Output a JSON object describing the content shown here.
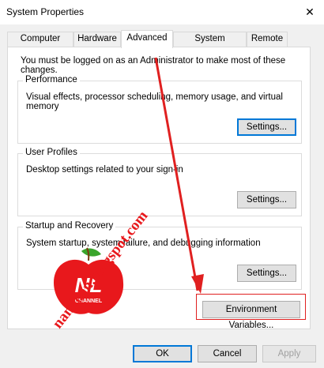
{
  "window": {
    "title": "System Properties",
    "close_glyph": "✕"
  },
  "tabs": [
    {
      "label": "Computer Name"
    },
    {
      "label": "Hardware"
    },
    {
      "label": "Advanced",
      "active": true
    },
    {
      "label": "System Protection"
    },
    {
      "label": "Remote"
    }
  ],
  "notice": "You must be logged on as an Administrator to make most of these changes.",
  "groups": {
    "performance": {
      "title": "Performance",
      "description": "Visual effects, processor scheduling, memory usage, and virtual memory",
      "button": "Settings..."
    },
    "user_profiles": {
      "title": "User Profiles",
      "description": "Desktop settings related to your sign-in",
      "button": "Settings..."
    },
    "startup_recovery": {
      "title": "Startup and Recovery",
      "description": "System startup, system failure, and debugging information",
      "button": "Settings..."
    }
  },
  "env_button": "Environment Variables...",
  "footer": {
    "ok": "OK",
    "cancel": "Cancel",
    "apply": "Apply"
  },
  "watermark": {
    "logo_text": "NL",
    "logo_subtext": "CHANNEL",
    "site": "namloan.blogspot.com"
  },
  "colors": {
    "annotation_red": "#e02020",
    "focus_blue": "#0078d7",
    "logo_red": "#e8181c",
    "logo_green": "#3aa52c"
  }
}
